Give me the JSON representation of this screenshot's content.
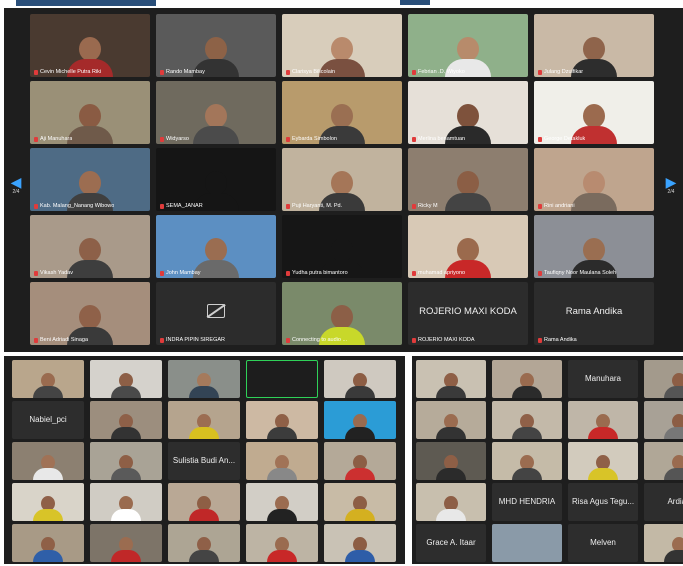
{
  "main_gallery": {
    "tiles": [
      {
        "name": "Cevin Michelle Putra Riki",
        "bg": "#4a3a30",
        "skin": "#9a6a4f",
        "shirt": "#a52a2a"
      },
      {
        "name": "Rando Mambay",
        "bg": "#5a5a5a",
        "skin": "#8d6247",
        "shirt": "#333333"
      },
      {
        "name": "Clarisya Bilicolain",
        "bg": "#d8cdbb",
        "skin": "#b98a6c",
        "shirt": "#7a5040"
      },
      {
        "name": "Febrian .D. Wiyoko",
        "bg": "#8fb08a",
        "skin": "#b78b6b",
        "shirt": "#e8e8e8"
      },
      {
        "name": "Julang Dzulfikar",
        "bg": "#c9b9a6",
        "skin": "#8f644b",
        "shirt": "#2d2d2d"
      },
      {
        "name": "Aji Manuhara",
        "bg": "#9a9077",
        "skin": "#8a5b43",
        "shirt": "#6f5a4a"
      },
      {
        "name": "Widyarso",
        "bg": "#6f6a5e",
        "skin": "#a3765a",
        "shirt": "#4b4b4b"
      },
      {
        "name": "Eybarda Simbolon",
        "bg": "#b89b6c",
        "skin": "#9a6f52",
        "shirt": "#3a3a3a"
      },
      {
        "name": "Merlina benamtuan",
        "bg": "#e6e0d8",
        "skin": "#7e523c",
        "shirt": "#2a2a2a"
      },
      {
        "name": "George Detakluk",
        "bg": "#f0efe9",
        "skin": "#9b6a4e",
        "shirt": "#c03030"
      },
      {
        "name": "Kab. Malang_Nanang Wibowo",
        "bg": "#4e6b85",
        "skin": "#9c6d51",
        "shirt": "#3f3f3f"
      },
      {
        "name": "SEMA_JANAR",
        "bg": "#151515",
        "skin": "#151515",
        "shirt": "#151515"
      },
      {
        "name": "Puji Haryanti, M. Pd.",
        "bg": "#c1b39e",
        "skin": "#a57658",
        "shirt": "#3a3a3a"
      },
      {
        "name": "Ricky M",
        "bg": "#8d7e6f",
        "skin": "#8b5e45",
        "shirt": "#444444"
      },
      {
        "name": "Rini andriani",
        "bg": "#bfa58e",
        "skin": "#b88b70",
        "shirt": "#7a6b5e"
      },
      {
        "name": "Vikash Yadav",
        "bg": "#a99a8a",
        "skin": "#8d6048",
        "shirt": "#3e3e3e"
      },
      {
        "name": "John Mambay",
        "bg": "#5c8fc2",
        "skin": "#9a6d51",
        "shirt": "#6a6a6a"
      },
      {
        "name": "Yudha putra bimantoro",
        "bg": "#161616",
        "skin": "#161616",
        "shirt": "#161616"
      },
      {
        "name": "muhamad apriyono",
        "bg": "#d8c9b6",
        "skin": "#9b6a4d",
        "shirt": "#c82828"
      },
      {
        "name": "Taufiqny Noor Maulana Soleh",
        "bg": "#8c8f96",
        "skin": "#9a6e51",
        "shirt": "#2b2b2b"
      },
      {
        "name": "Beni Adriadi Sinaga",
        "bg": "#a58e7c",
        "skin": "#8f6149",
        "shirt": "#3a3a3a"
      },
      {
        "name": "INDRA PIPIN SIREGAR",
        "camera_off": true
      },
      {
        "name": "Connecting to audio ...",
        "bg": "#7a8a6a",
        "skin": "#8c5f47",
        "shirt": "#c8d82a"
      },
      {
        "name": "ROJERIO MAXI KODA",
        "display_name": "ROJERIO MAXI KODA"
      },
      {
        "name": "Rama Andika",
        "display_name": "Rama Andika"
      }
    ],
    "prev_page": "2/4",
    "next_page": "2/4"
  },
  "lower_left": {
    "tiles": [
      {
        "bg": "#b9a68c",
        "skin": "#9a6b4f",
        "shirt": "#444444"
      },
      {
        "bg": "#d5d2cc",
        "skin": "#8d5f46",
        "shirt": "#4a4a4a"
      },
      {
        "bg": "#8a8f8a",
        "skin": "#a57a5c",
        "shirt": "#345"
      },
      {
        "bg": "#1d1d1d",
        "skin": "#1d1d1d",
        "shirt": "#1d1d1d",
        "active": true
      },
      {
        "bg": "#cfc9c0",
        "skin": "#8c5d44",
        "shirt": "#3a3a3a"
      },
      {
        "display_name": "Nabiel_pci"
      },
      {
        "bg": "#9c8e7e",
        "skin": "#8e6048",
        "shirt": "#333333"
      },
      {
        "bg": "#b5a48e",
        "skin": "#9c6d52",
        "shirt": "#d8c020"
      },
      {
        "bg": "#cdb9a3",
        "skin": "#8f6047",
        "shirt": "#3c3c3c"
      },
      {
        "bg": "#2b9cd6",
        "skin": "#996b50",
        "shirt": "#222222"
      },
      {
        "bg": "#8c8071",
        "skin": "#a07256",
        "shirt": "#e8e8e8"
      },
      {
        "bg": "#a9a396",
        "skin": "#8e5f46",
        "shirt": "#5a5a5a"
      },
      {
        "display_name": "Sulistia Budi An..."
      },
      {
        "bg": "#c0ab90",
        "skin": "#a17357",
        "shirt": "#888888"
      },
      {
        "bg": "#b4a998",
        "skin": "#8c5e45",
        "shirt": "#cc3030"
      },
      {
        "bg": "#d9d4c9",
        "skin": "#8f6048",
        "shirt": "#d8c428"
      },
      {
        "bg": "#d0ccc4",
        "skin": "#9a6b4f",
        "shirt": "#ffffff"
      },
      {
        "bg": "#b9a895",
        "skin": "#8e5f45",
        "shirt": "#c02828"
      },
      {
        "bg": "#d2cec6",
        "skin": "#9b6c50",
        "shirt": "#222222"
      },
      {
        "bg": "#c8bba6",
        "skin": "#8d5e45",
        "shirt": "#d4b020"
      },
      {
        "bg": "#a89a86",
        "skin": "#8f6047",
        "shirt": "#2f5fa8"
      },
      {
        "bg": "#7d7468",
        "skin": "#9b6c50",
        "shirt": "#c02828"
      },
      {
        "bg": "#ada594",
        "skin": "#8f6048",
        "shirt": "#444444"
      },
      {
        "bg": "#bdb4a4",
        "skin": "#9a6b4f",
        "shirt": "#c82828"
      },
      {
        "bg": "#c9c2b5",
        "skin": "#8c5d44",
        "shirt": "#2e5da8"
      }
    ]
  },
  "lower_right": {
    "tiles": [
      {
        "bg": "#c9c1b2",
        "skin": "#8e5f46",
        "shirt": "#3a3a3a"
      },
      {
        "bg": "#b3a696",
        "skin": "#9a6b4f",
        "shirt": "#2b2b2b"
      },
      {
        "display_name": "Manuhara"
      },
      {
        "bg": "#a39a8c",
        "skin": "#8d5e45",
        "shirt": "#555555"
      },
      {
        "bg": "#b6ab9a",
        "skin": "#9b6c50",
        "shirt": "#333333"
      },
      {
        "bg": "#c3b9a9",
        "skin": "#8f6048",
        "shirt": "#444444"
      },
      {
        "bg": "#bfb6a8",
        "skin": "#9a6b4f",
        "shirt": "#c82828"
      },
      {
        "bg": "#a8a196",
        "skin": "#8c5d44",
        "shirt": "#777777"
      },
      {
        "bg": "#5e5a52",
        "skin": "#8e5f46",
        "shirt": "#2b2b2b"
      },
      {
        "bg": "#c5bba8",
        "skin": "#9b6c50",
        "shirt": "#444444"
      },
      {
        "bg": "#d2cbbd",
        "skin": "#8f6048",
        "shirt": "#d8c428"
      },
      {
        "bg": "#b0a797",
        "skin": "#9a6b4f",
        "shirt": "#555555"
      },
      {
        "bg": "#c8bfae",
        "skin": "#8d5e45",
        "shirt": "#e8e8e8"
      },
      {
        "display_name": "MHD HENDRIA"
      },
      {
        "display_name": "Risa Agus Tegu..."
      },
      {
        "display_name": "Ardian"
      },
      {
        "display_name": "Grace A. Itaar"
      },
      {
        "bg": "#8a9aa8",
        "skin": "#8a9aa8",
        "shirt": "#6f7a5e"
      },
      {
        "display_name": "Melven"
      },
      {
        "bg": "#c3b9a6",
        "skin": "#9b6c50",
        "shirt": "#333333"
      }
    ]
  }
}
